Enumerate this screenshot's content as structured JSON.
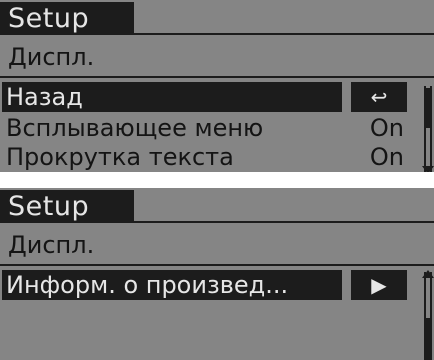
{
  "screens": [
    {
      "title": "Setup",
      "section": "Диспл.",
      "rows": [
        {
          "label": "Назад",
          "value": "↩",
          "selected": true
        },
        {
          "label": "Всплывающее меню",
          "value": "On",
          "selected": false
        },
        {
          "label": "Прокрутка текста",
          "value": "On",
          "selected": false
        }
      ]
    },
    {
      "title": "Setup",
      "section": "Диспл.",
      "rows": [
        {
          "label": "Информ. о произвед...",
          "value": "▶",
          "selected": true
        }
      ]
    }
  ],
  "colors": {
    "background": "#858585",
    "foreground": "#1c1c1c",
    "highlight_text": "#e6e6e6"
  }
}
